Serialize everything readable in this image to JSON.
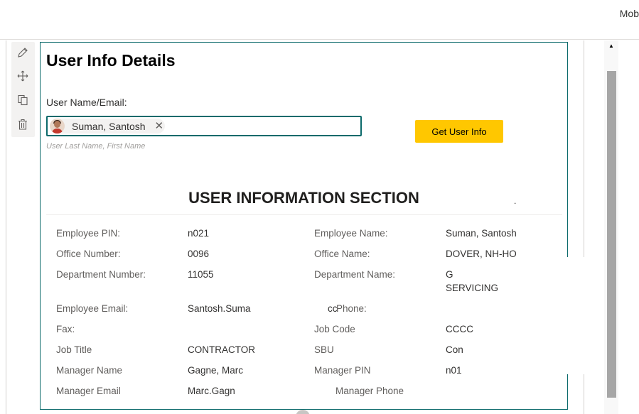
{
  "topbar": {
    "user_text": "Mob"
  },
  "toolbox": {
    "tools": [
      {
        "name": "edit-icon"
      },
      {
        "name": "move-icon"
      },
      {
        "name": "copy-icon"
      },
      {
        "name": "delete-icon"
      }
    ]
  },
  "webpart": {
    "title": "User Info Details",
    "field_label": "User Name/Email:",
    "picker": {
      "selected_person": "Suman, Santosh",
      "remove_glyph": "✕",
      "hint": "User Last Name, First Name"
    },
    "button_label": "Get User Info",
    "section_title": "USER INFORMATION SECTION",
    "section_dot": ".",
    "rows": [
      {
        "l1": "Employee PIN:",
        "v1": "n021",
        "l2": "Employee Name:",
        "v2": "Suman, Santosh"
      },
      {
        "l1": "Office Number:",
        "v1": "0096",
        "l2": "Office Name:",
        "v2": "DOVER, NH-HO"
      },
      {
        "l1": "Department Number:",
        "v1": "11055",
        "l2": "Department Name:",
        "v2": "G",
        "v2b": "SERVICING"
      },
      {
        "l1": "Employee Email:",
        "v1": "Santosh.Suma",
        "l2": "Phone:",
        "v2": "",
        "l2_prefix": "cc"
      },
      {
        "l1": "Fax:",
        "v1": "",
        "l2": "Job Code",
        "v2": "CCCC"
      },
      {
        "l1": "Job Title",
        "v1": "CONTRACTOR",
        "l2": "SBU",
        "v2": "Con"
      },
      {
        "l1": "Manager Name",
        "v1": "Gagne, Marc",
        "l2": "Manager PIN",
        "v2": "n01"
      },
      {
        "l1": "Manager Email",
        "v1": "Marc.Gagn",
        "l2": "Manager Phone",
        "v2": ""
      }
    ]
  },
  "colors": {
    "accent": "#0b6a6b",
    "button": "#ffc700"
  }
}
